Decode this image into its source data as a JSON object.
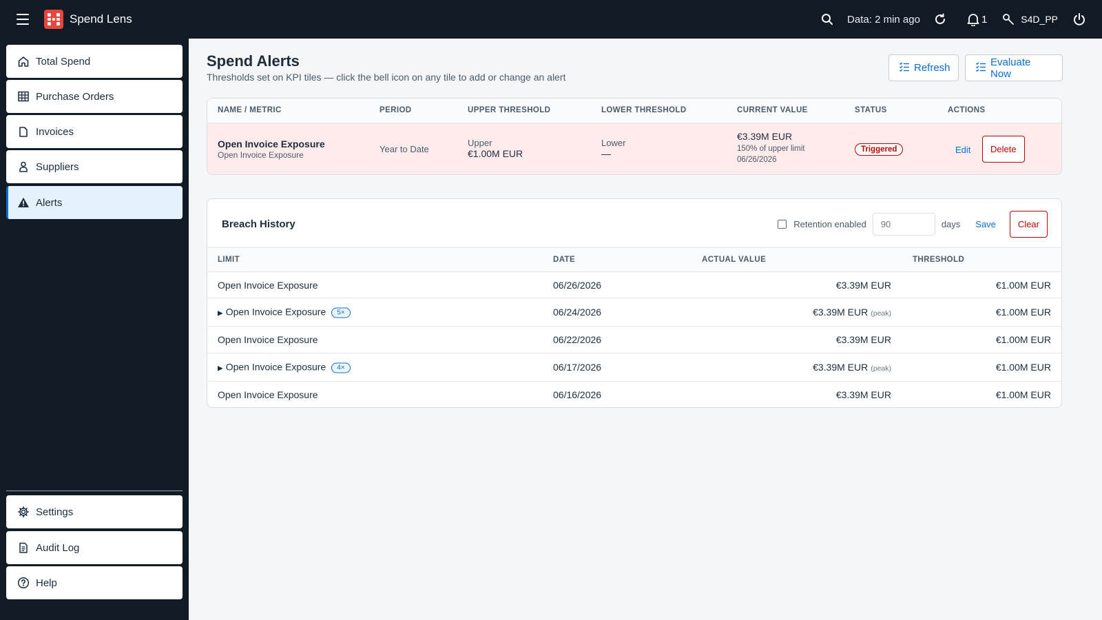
{
  "topbar": {
    "app_title": "Spend Lens",
    "data_age": "Data: 2 min ago",
    "notification_count": "1",
    "user": "S4D_PP"
  },
  "sidebar": {
    "items": [
      {
        "label": "Total Spend",
        "icon": "home-icon"
      },
      {
        "label": "Purchase Orders",
        "icon": "grid-icon"
      },
      {
        "label": "Invoices",
        "icon": "document-icon"
      },
      {
        "label": "Suppliers",
        "icon": "person-icon"
      },
      {
        "label": "Alerts",
        "icon": "warning-icon",
        "active": true
      }
    ],
    "bottom_items": [
      {
        "label": "Settings",
        "icon": "gear-icon"
      },
      {
        "label": "Audit Log",
        "icon": "log-icon"
      },
      {
        "label": "Help",
        "icon": "help-icon"
      }
    ]
  },
  "page": {
    "title": "Spend Alerts",
    "subtitle": "Thresholds set on KPI tiles — click the bell icon on any tile to add or change an alert",
    "refresh_label": "Refresh",
    "evaluate_label": "Evaluate Now"
  },
  "alerts_table": {
    "headers": {
      "name": "NAME / METRIC",
      "period": "PERIOD",
      "upper": "UPPER THRESHOLD",
      "lower": "LOWER THRESHOLD",
      "current": "CURRENT VALUE",
      "status": "STATUS",
      "actions": "ACTIONS"
    },
    "row": {
      "name": "Open Invoice Exposure",
      "metric": "Open Invoice Exposure",
      "period": "Year to Date",
      "upper_label": "Upper",
      "upper_value": "€1.00M EUR",
      "lower_label": "Lower",
      "lower_value": "—",
      "current_value": "€3.39M EUR",
      "current_pct": "150% of upper limit",
      "current_date": "06/26/2026",
      "status": "Triggered",
      "edit_label": "Edit",
      "delete_label": "Delete"
    }
  },
  "history": {
    "title": "Breach History",
    "retention_label": "Retention enabled",
    "retention_checked": false,
    "days_placeholder": "90",
    "days_label": "days",
    "save_label": "Save",
    "clear_label": "Clear",
    "headers": {
      "limit": "LIMIT",
      "date": "DATE",
      "actual": "ACTUAL VALUE",
      "threshold": "THRESHOLD"
    },
    "rows": [
      {
        "limit": "Open Invoice Exposure",
        "expandable": false,
        "count": "",
        "date": "06/26/2026",
        "actual": "€3.39M EUR",
        "peak": "",
        "threshold": "€1.00M EUR"
      },
      {
        "limit": "Open Invoice Exposure",
        "expandable": true,
        "count": "5×",
        "date": "06/24/2026",
        "actual": "€3.39M EUR",
        "peak": "(peak)",
        "threshold": "€1.00M EUR"
      },
      {
        "limit": "Open Invoice Exposure",
        "expandable": false,
        "count": "",
        "date": "06/22/2026",
        "actual": "€3.39M EUR",
        "peak": "",
        "threshold": "€1.00M EUR"
      },
      {
        "limit": "Open Invoice Exposure",
        "expandable": true,
        "count": "4×",
        "date": "06/17/2026",
        "actual": "€3.39M EUR",
        "peak": "(peak)",
        "threshold": "€1.00M EUR"
      },
      {
        "limit": "Open Invoice Exposure",
        "expandable": false,
        "count": "",
        "date": "06/16/2026",
        "actual": "€3.39M EUR",
        "peak": "",
        "threshold": "€1.00M EUR"
      }
    ]
  },
  "colors": {
    "accent": "#0a6ed1",
    "danger": "#bb0000",
    "shell": "#111b26",
    "alert_row_bg": "#ffebeb"
  }
}
